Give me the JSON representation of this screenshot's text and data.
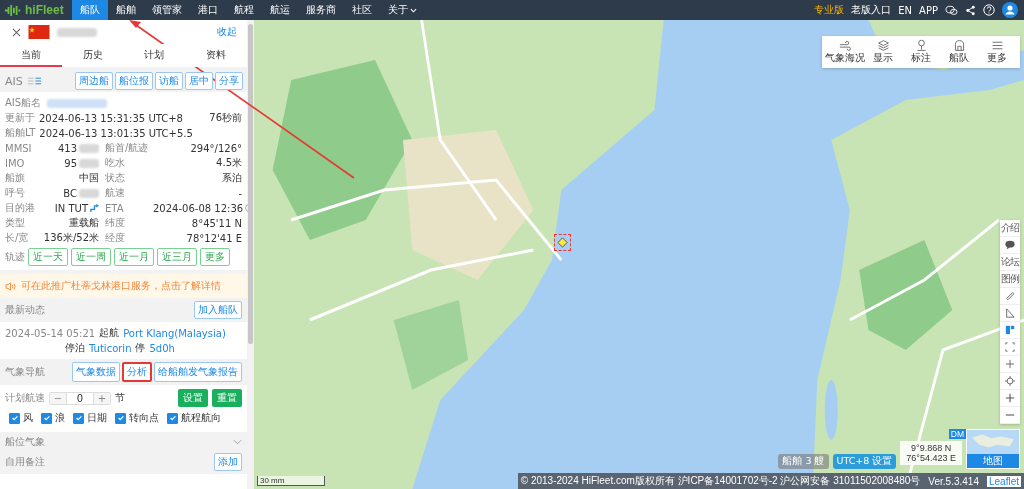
{
  "top_nav": {
    "logo": "hiFleet",
    "items": [
      {
        "label": "船队",
        "selected": true,
        "menu": false
      },
      {
        "label": "船舶",
        "selected": false,
        "menu": false
      },
      {
        "label": "领管家",
        "selected": false,
        "menu": false
      },
      {
        "label": "港口",
        "selected": false,
        "menu": false
      },
      {
        "label": "航程",
        "selected": false,
        "menu": false
      },
      {
        "label": "航运",
        "selected": false,
        "menu": false
      },
      {
        "label": "服务商",
        "selected": false,
        "menu": false
      },
      {
        "label": "社区",
        "selected": false,
        "menu": false
      },
      {
        "label": "关于",
        "selected": false,
        "menu": true
      }
    ],
    "edition": "专业版",
    "old_version": "老版入口",
    "language": "EN",
    "app": "APP"
  },
  "vessel_panel": {
    "collapse": "收起",
    "tabs": [
      {
        "label": "当前",
        "selected": true
      },
      {
        "label": "历史",
        "selected": false
      },
      {
        "label": "计划",
        "selected": false
      },
      {
        "label": "资料",
        "selected": false
      }
    ],
    "ais_label": "AIS",
    "ais_buttons": [
      "周边船",
      "船位报",
      "访船",
      "居中",
      "分享"
    ],
    "ais_name_label": "AIS船名",
    "updated": {
      "label": "更新于",
      "value": "2024-06-13 15:31:35 UTC+8",
      "ago": "76秒前"
    },
    "local_time": {
      "label": "船舶LT",
      "value": "2024-06-13 13:01:35 UTC+5.5"
    },
    "details": [
      {
        "label": "MMSI",
        "value": "413",
        "redacted": true,
        "label2": "船首/航迹",
        "value2": "294°/126°"
      },
      {
        "label": "IMO",
        "value": "95",
        "redacted": true,
        "label2": "吃水",
        "value2": "4.5米"
      },
      {
        "label": "船旗",
        "value": "中国",
        "redacted": false,
        "label2": "状态",
        "value2": "系泊"
      },
      {
        "label": "呼号",
        "value": "BC",
        "redacted": true,
        "label2": "航速",
        "value2": "-"
      },
      {
        "label": "目的港",
        "value": "IN TUT",
        "redacted": false,
        "label2": "ETA",
        "value2": "2024-06-08 12:36"
      },
      {
        "label": "类型",
        "value": "重载船",
        "redacted": false,
        "label2": "纬度",
        "value2": "8°45'11 N"
      },
      {
        "label": "长/宽",
        "value": "136米/52米",
        "redacted": false,
        "label2": "经度",
        "value2": "78°12'41 E"
      }
    ],
    "track": {
      "label": "轨迹",
      "buttons": [
        "近一天",
        "近一周",
        "近一月",
        "近三月",
        "更多"
      ]
    },
    "notice": "可在此推广杜蒂戈林港口服务，点击了解详情",
    "latest": {
      "title": "最新动态",
      "button": "加入船队",
      "time": "2024-05-14 05:21",
      "departed": "起航",
      "from": "Port Klang(Malaysia)",
      "berthed": "停泊",
      "port": "Tuticorin",
      "stay_label": "停",
      "stay": "5d0h"
    },
    "weather_nav": {
      "title": "气象导航",
      "buttons": [
        {
          "label": "气象数据",
          "highlighted": false
        },
        {
          "label": "分析",
          "highlighted": true
        },
        {
          "label": "给船舶发气象报告",
          "highlighted": false
        }
      ],
      "speed_label": "计划航速",
      "minus": "−",
      "speed": "0",
      "plus": "+",
      "unit": "节",
      "set": "设置",
      "reset": "重置",
      "layers": [
        {
          "label": "风",
          "checked": true
        },
        {
          "label": "浪",
          "checked": true
        },
        {
          "label": "日期",
          "checked": true
        },
        {
          "label": "转向点",
          "checked": true
        },
        {
          "label": "航程航向",
          "checked": true
        }
      ]
    },
    "ship_weather": {
      "title": "船位气象",
      "expanded": false
    },
    "notes": {
      "title": "自用备注",
      "button": "添加"
    }
  },
  "map": {
    "toolbar": [
      {
        "label": "气象海况"
      },
      {
        "label": "显示"
      },
      {
        "label": "标注"
      },
      {
        "label": "船队"
      },
      {
        "label": "更多"
      }
    ],
    "side_tools": [
      {
        "kind": "text",
        "label": "介绍"
      },
      {
        "kind": "icon"
      },
      {
        "kind": "text",
        "label": "论坛"
      },
      {
        "kind": "text",
        "label": "图例"
      },
      {
        "kind": "icon"
      },
      {
        "kind": "icon"
      },
      {
        "kind": "icon"
      },
      {
        "kind": "icon"
      },
      {
        "kind": "icon"
      },
      {
        "kind": "icon"
      },
      {
        "kind": "icon"
      },
      {
        "kind": "icon"
      }
    ],
    "vessel_count": "船舶 3 艘",
    "timezone": "UTC+8 设置",
    "lat": "9°9.868 N",
    "lon": "76°54.423 E",
    "dm": "DM",
    "minimap_label": "地图",
    "scale": "30 mm",
    "copyright": "© 2013-2024 HiFleet.com版权所有 沪ICP备14001702号-2 沪公网安备 31011502008480号",
    "version": "Ver.5.3.414",
    "attribution": "Leaflet"
  }
}
